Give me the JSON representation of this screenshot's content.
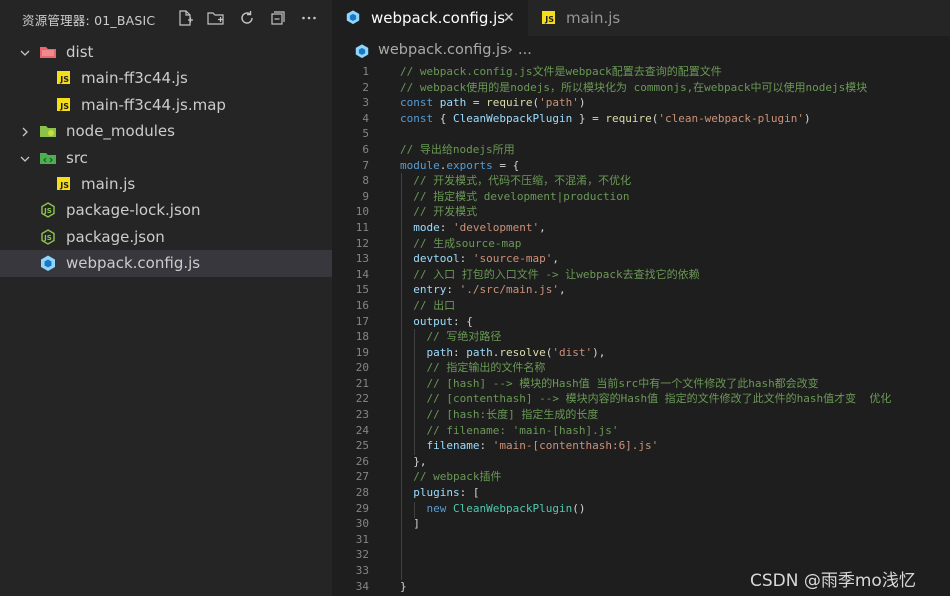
{
  "explorer": {
    "title": "资源管理器: 01_BASIC",
    "actions": [
      {
        "name": "new-file-icon"
      },
      {
        "name": "new-folder-icon"
      },
      {
        "name": "refresh-icon"
      },
      {
        "name": "collapse-all-icon"
      },
      {
        "name": "more-icon"
      }
    ],
    "tree": [
      {
        "label": "dist",
        "type": "folder-open",
        "icon": "dist-folder-icon",
        "color": "#e8676c",
        "depth": 0
      },
      {
        "label": "main-ff3c44.js",
        "type": "js",
        "icon": "js-file-icon",
        "depth": 1
      },
      {
        "label": "main-ff3c44.js.map",
        "type": "js",
        "icon": "js-file-icon",
        "depth": 1
      },
      {
        "label": "node_modules",
        "type": "folder-closed",
        "icon": "node-folder-icon",
        "color": "#8bc34a",
        "depth": 0
      },
      {
        "label": "src",
        "type": "folder-open",
        "icon": "src-folder-icon",
        "color": "#4caf50",
        "depth": 0
      },
      {
        "label": "main.js",
        "type": "js",
        "icon": "js-file-icon",
        "depth": 1
      },
      {
        "label": "package-lock.json",
        "type": "node",
        "icon": "nodejs-icon",
        "depth": 0
      },
      {
        "label": "package.json",
        "type": "node",
        "icon": "nodejs-icon",
        "depth": 0
      },
      {
        "label": "webpack.config.js",
        "type": "webpack",
        "icon": "webpack-icon",
        "depth": 0,
        "selected": true
      }
    ]
  },
  "tabs": [
    {
      "label": "webpack.config.js",
      "active": true,
      "icon": "webpack-icon",
      "close": "✕"
    },
    {
      "label": "main.js",
      "active": false,
      "icon": "js-file-icon"
    }
  ],
  "breadcrumb": {
    "file": "webpack.config.js",
    "separator": "›",
    "rest": "..."
  },
  "colors": {
    "accent_js": "#f5de19",
    "webpack": "#8ed6fb",
    "selection": "#37373d"
  },
  "code": [
    [
      1,
      [
        [
          "c",
          "// webpack.config.js文件是webpack配置去查询的配置文件"
        ]
      ]
    ],
    [
      2,
      [
        [
          "c",
          "// webpack使用的是nodejs，所以模块化为 commonjs,在webpack中可以使用nodejs模块"
        ]
      ]
    ],
    [
      3,
      [
        [
          "k",
          "const "
        ],
        [
          "v",
          "path"
        ],
        [
          "p",
          " = "
        ],
        [
          "f",
          "require"
        ],
        [
          "p",
          "("
        ],
        [
          "s",
          "'path'"
        ],
        [
          "p",
          ")"
        ]
      ]
    ],
    [
      4,
      [
        [
          "k",
          "const "
        ],
        [
          "p",
          "{ "
        ],
        [
          "v",
          "CleanWebpackPlugin"
        ],
        [
          "p",
          " } = "
        ],
        [
          "f",
          "require"
        ],
        [
          "p",
          "("
        ],
        [
          "s",
          "'clean-webpack-plugin'"
        ],
        [
          "p",
          ")"
        ]
      ]
    ],
    [
      5,
      []
    ],
    [
      6,
      [
        [
          "c",
          "// 导出给nodejs所用"
        ]
      ]
    ],
    [
      7,
      [
        [
          "k",
          "module"
        ],
        [
          "p",
          "."
        ],
        [
          "k",
          "exports"
        ],
        [
          "p",
          " = {"
        ]
      ]
    ],
    [
      8,
      [
        [
          "p",
          "  "
        ],
        [
          "c",
          "// 开发模式，代码不压缩，不混淆，不优化"
        ]
      ]
    ],
    [
      9,
      [
        [
          "p",
          "  "
        ],
        [
          "c",
          "// 指定模式 development|production"
        ]
      ]
    ],
    [
      10,
      [
        [
          "p",
          "  "
        ],
        [
          "c",
          "// 开发模式"
        ]
      ]
    ],
    [
      11,
      [
        [
          "p",
          "  "
        ],
        [
          "v",
          "mode"
        ],
        [
          "p",
          ": "
        ],
        [
          "s",
          "'development'"
        ],
        [
          "p",
          ","
        ]
      ]
    ],
    [
      12,
      [
        [
          "p",
          "  "
        ],
        [
          "c",
          "// 生成source-map"
        ]
      ]
    ],
    [
      13,
      [
        [
          "p",
          "  "
        ],
        [
          "v",
          "devtool"
        ],
        [
          "p",
          ": "
        ],
        [
          "s",
          "'source-map'"
        ],
        [
          "p",
          ","
        ]
      ]
    ],
    [
      14,
      [
        [
          "p",
          "  "
        ],
        [
          "c",
          "// 入口 打包的入口文件 -> 让webpack去查找它的依赖"
        ]
      ]
    ],
    [
      15,
      [
        [
          "p",
          "  "
        ],
        [
          "v",
          "entry"
        ],
        [
          "p",
          ": "
        ],
        [
          "s",
          "'./src/main.js'"
        ],
        [
          "p",
          ","
        ]
      ]
    ],
    [
      16,
      [
        [
          "p",
          "  "
        ],
        [
          "c",
          "// 出口"
        ]
      ]
    ],
    [
      17,
      [
        [
          "p",
          "  "
        ],
        [
          "v",
          "output"
        ],
        [
          "p",
          ": {"
        ]
      ]
    ],
    [
      18,
      [
        [
          "p",
          "    "
        ],
        [
          "c",
          "// 写绝对路径"
        ]
      ]
    ],
    [
      19,
      [
        [
          "p",
          "    "
        ],
        [
          "v",
          "path"
        ],
        [
          "p",
          ": "
        ],
        [
          "v",
          "path"
        ],
        [
          "p",
          "."
        ],
        [
          "f",
          "resolve"
        ],
        [
          "p",
          "("
        ],
        [
          "s",
          "'dist'"
        ],
        [
          "p",
          "),"
        ]
      ]
    ],
    [
      20,
      [
        [
          "p",
          "    "
        ],
        [
          "c",
          "// 指定输出的文件名称"
        ]
      ]
    ],
    [
      21,
      [
        [
          "p",
          "    "
        ],
        [
          "c",
          "// [hash] --> 模块的Hash值 当前src中有一个文件修改了此hash都会改变"
        ]
      ]
    ],
    [
      22,
      [
        [
          "p",
          "    "
        ],
        [
          "c",
          "// [contenthash] --> 模块内容的Hash值 指定的文件修改了此文件的hash值才变  优化"
        ]
      ]
    ],
    [
      23,
      [
        [
          "p",
          "    "
        ],
        [
          "c",
          "// [hash:长度] 指定生成的长度"
        ]
      ]
    ],
    [
      24,
      [
        [
          "p",
          "    "
        ],
        [
          "c",
          "// filename: 'main-[hash].js'"
        ]
      ]
    ],
    [
      25,
      [
        [
          "p",
          "    "
        ],
        [
          "v",
          "filename"
        ],
        [
          "p",
          ": "
        ],
        [
          "s",
          "'main-[contenthash:6].js'"
        ]
      ]
    ],
    [
      26,
      [
        [
          "p",
          "  },"
        ]
      ]
    ],
    [
      27,
      [
        [
          "p",
          "  "
        ],
        [
          "c",
          "// webpack插件"
        ]
      ]
    ],
    [
      28,
      [
        [
          "p",
          "  "
        ],
        [
          "v",
          "plugins"
        ],
        [
          "p",
          ": ["
        ]
      ]
    ],
    [
      29,
      [
        [
          "p",
          "    "
        ],
        [
          "k",
          "new "
        ],
        [
          "cls",
          "CleanWebpackPlugin"
        ],
        [
          "p",
          "()"
        ]
      ]
    ],
    [
      30,
      [
        [
          "p",
          "  ]"
        ]
      ]
    ],
    [
      31,
      []
    ],
    [
      32,
      []
    ],
    [
      33,
      []
    ],
    [
      34,
      [
        [
          "p",
          "}"
        ]
      ]
    ]
  ],
  "watermark": "CSDN @雨季mo浅忆"
}
